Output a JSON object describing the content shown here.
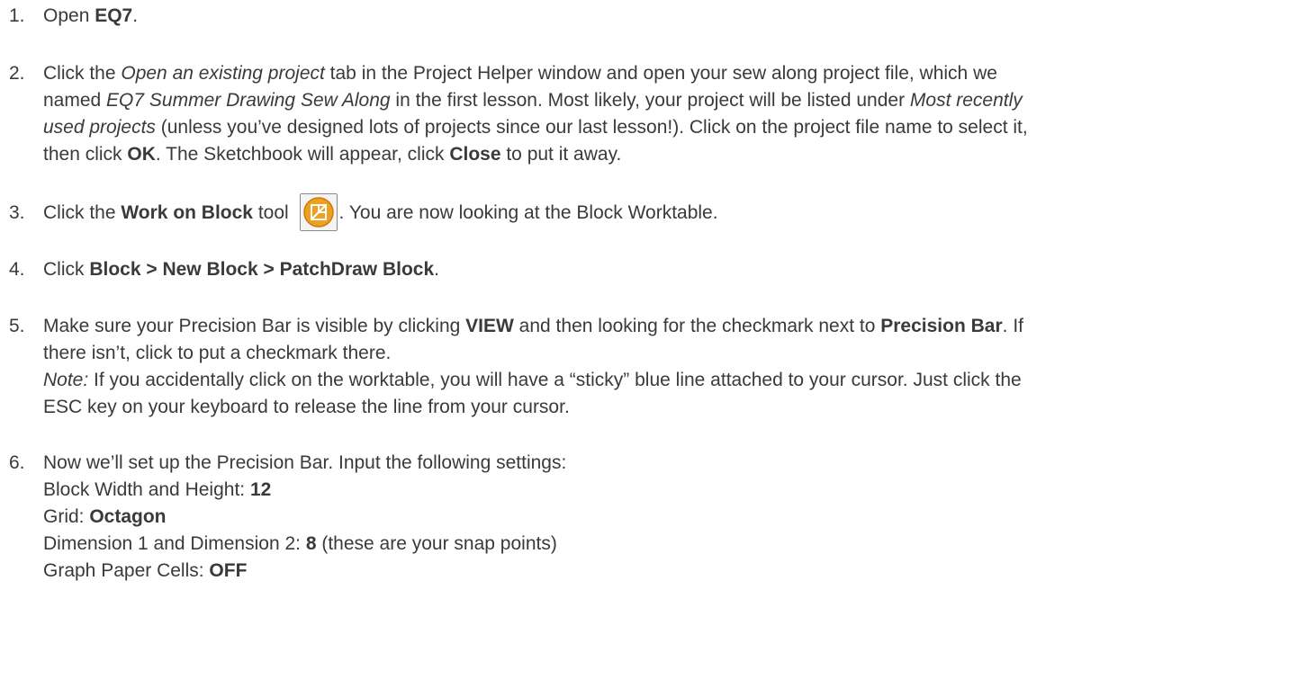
{
  "steps": [
    {
      "num": "1.",
      "lines": [
        [
          {
            "t": "Open "
          },
          {
            "t": "EQ7",
            "s": "b"
          },
          {
            "t": "."
          }
        ]
      ]
    },
    {
      "num": "2.",
      "lines": [
        [
          {
            "t": "Click the "
          },
          {
            "t": "Open an existing project",
            "s": "i"
          },
          {
            "t": " tab in the Project Helper window and open your sew along project file, which we"
          }
        ],
        [
          {
            "t": "named "
          },
          {
            "t": "EQ7 Summer Drawing Sew Along",
            "s": "i"
          },
          {
            "t": " in the first lesson. Most likely, your project will be listed under "
          },
          {
            "t": "Most recently",
            "s": "i"
          }
        ],
        [
          {
            "t": "used projects",
            "s": "i"
          },
          {
            "t": " (unless you’ve designed lots of projects since our last lesson!). Click on the project file name to select it,"
          }
        ],
        [
          {
            "t": "then click "
          },
          {
            "t": "OK",
            "s": "b"
          },
          {
            "t": ". The Sketchbook will appear, click "
          },
          {
            "t": "Close",
            "s": "b"
          },
          {
            "t": " to put it away."
          }
        ]
      ]
    },
    {
      "num": "3.",
      "lines": [
        [
          {
            "t": "Click the "
          },
          {
            "t": "Work on Block",
            "s": "b"
          },
          {
            "t": " tool "
          },
          {
            "icon": "work-on-block-icon"
          },
          {
            "t": ". You are now looking at the Block Worktable."
          }
        ]
      ]
    },
    {
      "num": "4.",
      "lines": [
        [
          {
            "t": "Click "
          },
          {
            "t": "Block > New Block > PatchDraw Block",
            "s": "b"
          },
          {
            "t": "."
          }
        ]
      ]
    },
    {
      "num": "5.",
      "lines": [
        [
          {
            "t": "Make sure your Precision Bar is visible by clicking "
          },
          {
            "t": "VIEW",
            "s": "b"
          },
          {
            "t": " and then looking for the checkmark next to "
          },
          {
            "t": "Precision Bar",
            "s": "b"
          },
          {
            "t": ". If"
          }
        ],
        [
          {
            "t": "there isn’t, click to put a checkmark there."
          }
        ],
        [
          {
            "t": "Note:",
            "s": "i"
          },
          {
            "t": " If you accidentally click on the worktable, you will have a “sticky” blue line attached to your cursor. Just click the"
          }
        ],
        [
          {
            "t": "ESC key on your keyboard to release the line from your cursor."
          }
        ]
      ]
    },
    {
      "num": "6.",
      "lines": [
        [
          {
            "t": "Now we’ll set up the Precision Bar. Input the following settings:"
          }
        ],
        [
          {
            "t": "Block Width and Height: "
          },
          {
            "t": "12",
            "s": "b"
          }
        ],
        [
          {
            "t": "Grid: "
          },
          {
            "t": "Octagon",
            "s": "b"
          }
        ],
        [
          {
            "t": "Dimension 1 and Dimension 2: "
          },
          {
            "t": "8",
            "s": "b"
          },
          {
            "t": " (these are your snap points)"
          }
        ],
        [
          {
            "t": "Graph Paper Cells: "
          },
          {
            "t": "OFF",
            "s": "b"
          }
        ]
      ]
    }
  ],
  "colors": {
    "text": "#3a3a3a",
    "icon_orange": "#f0a020",
    "icon_border": "#8a8a8a"
  }
}
